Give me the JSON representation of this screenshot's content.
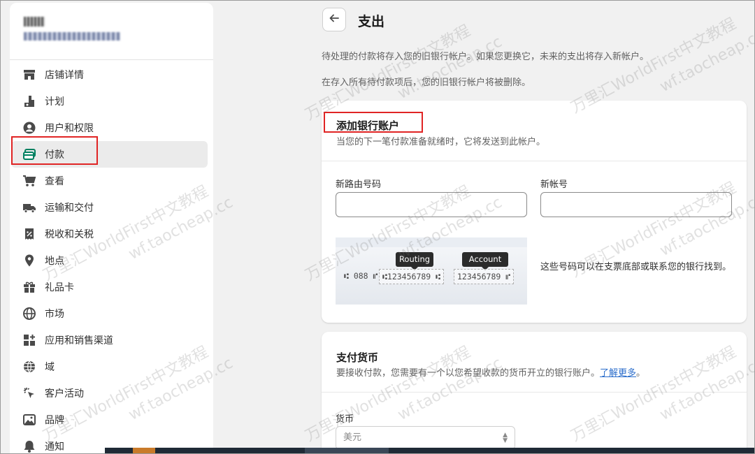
{
  "sidebar": {
    "items": [
      {
        "label": "店铺详情",
        "icon": "store-icon"
      },
      {
        "label": "计划",
        "icon": "plan-icon"
      },
      {
        "label": "用户和权限",
        "icon": "user-icon"
      },
      {
        "label": "付款",
        "icon": "payment-icon",
        "active": true
      },
      {
        "label": "查看",
        "icon": "cart-icon"
      },
      {
        "label": "运输和交付",
        "icon": "truck-icon"
      },
      {
        "label": "税收和关税",
        "icon": "tax-icon"
      },
      {
        "label": "地点",
        "icon": "location-icon"
      },
      {
        "label": "礼品卡",
        "icon": "gift-icon"
      },
      {
        "label": "市场",
        "icon": "globe-icon"
      },
      {
        "label": "应用和销售渠道",
        "icon": "apps-icon"
      },
      {
        "label": "域",
        "icon": "domain-icon"
      },
      {
        "label": "客户活动",
        "icon": "activity-icon"
      },
      {
        "label": "品牌",
        "icon": "brand-icon"
      },
      {
        "label": "通知",
        "icon": "bell-icon"
      }
    ]
  },
  "header": {
    "title": "支出"
  },
  "intro": {
    "line1": "待处理的付款将存入您的旧银行帐户。如果您更换它，未来的支出将存入新帐户。",
    "line2": "在存入所有待付款项后，您的旧银行帐户将被删除。"
  },
  "bank_card": {
    "title": "添加银行账户",
    "subtitle": "当您的下一笔付款准备就绪时，它将发送到此帐户。",
    "routing_label": "新路由号码",
    "account_label": "新帐号",
    "routing_value": "",
    "account_value": "",
    "check_tag_routing": "Routing",
    "check_tag_account": "Account",
    "check_micr_prefix": "⑆ 088 ⑈",
    "check_micr_routing": "⑆123456789 ⑆",
    "check_micr_account": "123456789 ⑈",
    "check_help": "这些号码可以在支票底部或联系您的银行找到。"
  },
  "currency_card": {
    "title": "支付货币",
    "subtitle": "要接收付款，您需要有一个以您希望收款的货币开立的银行账户。",
    "learn_more": "了解更多",
    "subtitle_end": "。",
    "currency_label": "货币",
    "currency_value": "美元"
  },
  "watermark": {
    "text1": "万里汇WorldFirst中文教程",
    "text2": "wf.taocheap.cc"
  },
  "colors": {
    "highlight": "#e02424",
    "link": "#2c6ecb",
    "active_bg": "#ebebeb"
  }
}
